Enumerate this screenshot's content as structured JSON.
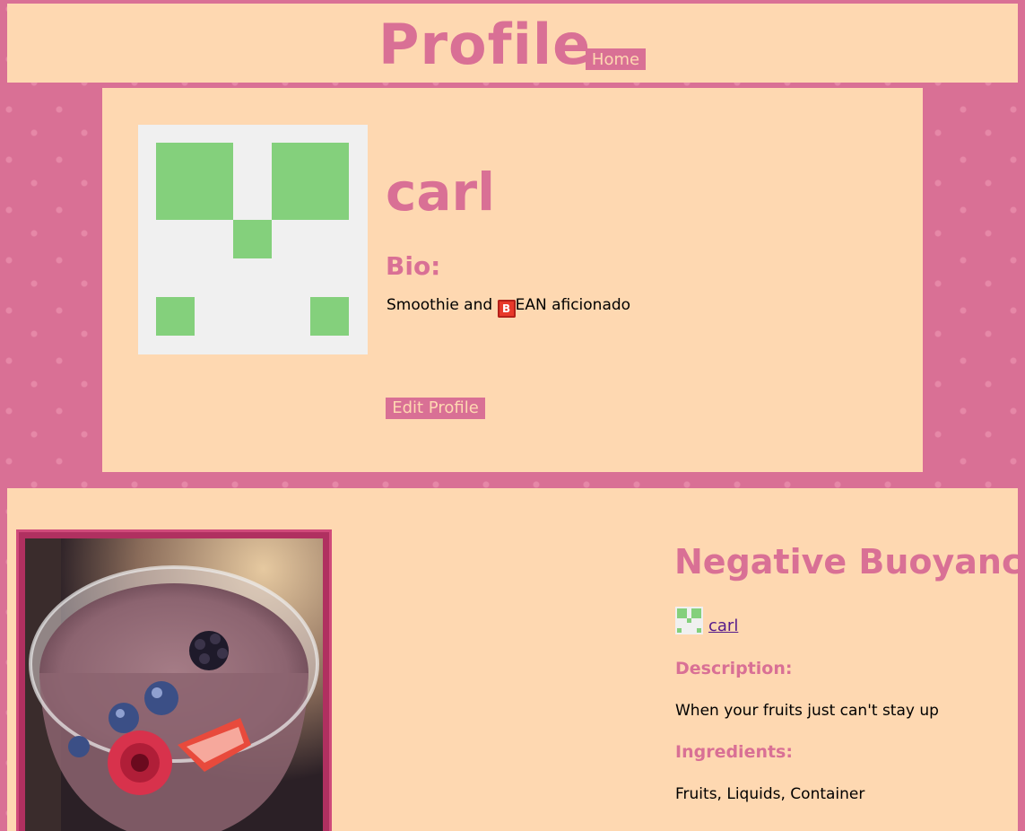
{
  "header": {
    "title": "Profile",
    "home_label": "Home"
  },
  "profile": {
    "username": "carl",
    "bio_heading": "Bio:",
    "bio_before": "Smoothie and ",
    "bio_emoji": "B",
    "bio_after": "EAN aficionado",
    "edit_label": "Edit Profile",
    "avatar_icon": "identicon-avatar"
  },
  "post": {
    "title": "Negative Buoyancy",
    "author": "carl",
    "description_heading": "Description:",
    "description": "When your fruits just can't stay up",
    "ingredients_heading": "Ingredients:",
    "ingredients": "Fruits, Liquids, Container",
    "image_icon": "smoothie-photo"
  },
  "colors": {
    "background": "#d97095",
    "panel": "#fed8b1",
    "accent": "#d97095",
    "avatar_green": "#84d07c",
    "link": "#551a8b"
  }
}
